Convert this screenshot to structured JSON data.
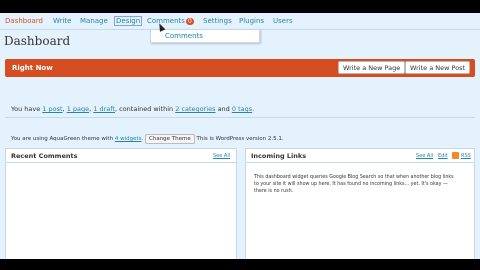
{
  "nav": {
    "items": [
      {
        "label": "Dashboard"
      },
      {
        "label": "Write"
      },
      {
        "label": "Manage"
      },
      {
        "label": "Design"
      },
      {
        "label": "Comments"
      },
      {
        "label": "Settings"
      },
      {
        "label": "Plugins"
      },
      {
        "label": "Users"
      }
    ],
    "comments_badge": "0",
    "dropdown_item": "Comments"
  },
  "page_title": "Dashboard",
  "right_now": {
    "title": "Right Now",
    "write_post": "Write a New Post",
    "write_page": "Write a New Page"
  },
  "summary": {
    "t1": "You have ",
    "posts": "1 post",
    "t2": ", ",
    "pages": "1 page",
    "t3": ", ",
    "drafts": "1 draft",
    "t4": ", contained within ",
    "categories": "2 categories",
    "t5": " and ",
    "tags": "0 tags",
    "t6": ".",
    "theme_t1": "You are using AquaGreen theme with ",
    "widgets": "4 widgets",
    "theme_t2": ".",
    "change_theme": "Change Theme",
    "theme_t3": " This is WordPress version 2.5.1."
  },
  "recent_comments": {
    "title": "Recent Comments",
    "see_all": "See All"
  },
  "incoming_links": {
    "title": "Incoming Links",
    "see_all": "See All",
    "edit": "Edit",
    "rss": "RSS",
    "body": "This dashboard widget queries Google Blog Search so that when another blog links to your site it will show up here. It has found no incoming links... yet. It's okay — there is no rush."
  },
  "colors": {
    "accent": "#d54e21",
    "link": "#2583ad",
    "background": "#e4f2fd"
  }
}
